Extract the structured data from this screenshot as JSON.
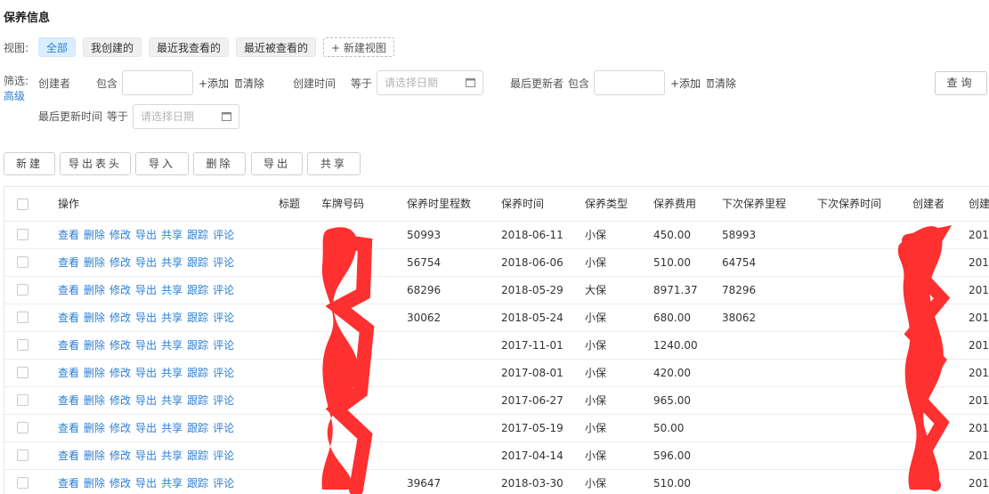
{
  "page": {
    "title": "保养信息"
  },
  "views": {
    "label": "视图:",
    "tabs": [
      "全部",
      "我创建的",
      "最近我查看的",
      "最近被查看的"
    ],
    "new_view": "+ 新建视图"
  },
  "filters": {
    "label": "筛选:",
    "advanced": "高级",
    "creator": {
      "label": "创建者",
      "op": "包含",
      "add": "+添加",
      "clear": "清除"
    },
    "create_time": {
      "label": "创建时间",
      "op": "等于",
      "placeholder": "请选择日期"
    },
    "last_updater": {
      "label": "最后更新者",
      "op": "包含",
      "add": "+添加",
      "clear": "清除"
    },
    "last_update_time": {
      "label": "最后更新时间",
      "op": "等于",
      "placeholder": "请选择日期"
    },
    "query": "查询"
  },
  "toolbar": {
    "new": "新建",
    "export_header": "导出表头",
    "import": "导入",
    "delete": "删除",
    "export": "导出",
    "share": "共享"
  },
  "table": {
    "headers": [
      "操作",
      "标题",
      "车牌号码",
      "保养时里程数",
      "保养时间",
      "保养类型",
      "保养费用",
      "下次保养里程",
      "下次保养时间",
      "创建者",
      "创建"
    ],
    "row_ops": [
      "查看",
      "删除",
      "修改",
      "导出",
      "共享",
      "跟踪",
      "评论"
    ],
    "rows": [
      {
        "mileage": "50993",
        "date": "2018-06-11",
        "type": "小保",
        "cost": "450.00",
        "next": "58993",
        "created": "201"
      },
      {
        "mileage": "56754",
        "date": "2018-06-06",
        "type": "小保",
        "cost": "510.00",
        "next": "64754",
        "created": "201"
      },
      {
        "mileage": "68296",
        "date": "2018-05-29",
        "type": "大保",
        "cost": "8971.37",
        "next": "78296",
        "created": "201"
      },
      {
        "mileage": "30062",
        "date": "2018-05-24",
        "type": "小保",
        "cost": "680.00",
        "next": "38062",
        "created": "201"
      },
      {
        "mileage": "",
        "date": "2017-11-01",
        "type": "小保",
        "cost": "1240.00",
        "next": "",
        "created": "201"
      },
      {
        "mileage": "",
        "date": "2017-08-01",
        "type": "小保",
        "cost": "420.00",
        "next": "",
        "created": "201"
      },
      {
        "mileage": "",
        "date": "2017-06-27",
        "type": "小保",
        "cost": "965.00",
        "next": "",
        "created": "201"
      },
      {
        "mileage": "",
        "date": "2017-05-19",
        "type": "小保",
        "cost": "50.00",
        "next": "",
        "created": "201"
      },
      {
        "mileage": "",
        "date": "2017-04-14",
        "type": "小保",
        "cost": "596.00",
        "next": "",
        "created": "201"
      },
      {
        "mileage": "39647",
        "date": "2018-03-30",
        "type": "小保",
        "cost": "510.00",
        "next": "",
        "created": "201"
      }
    ]
  },
  "colors": {
    "accent": "#2b7fd3",
    "active_tab_bg": "#dbeefe",
    "redaction": "#ff3030"
  }
}
